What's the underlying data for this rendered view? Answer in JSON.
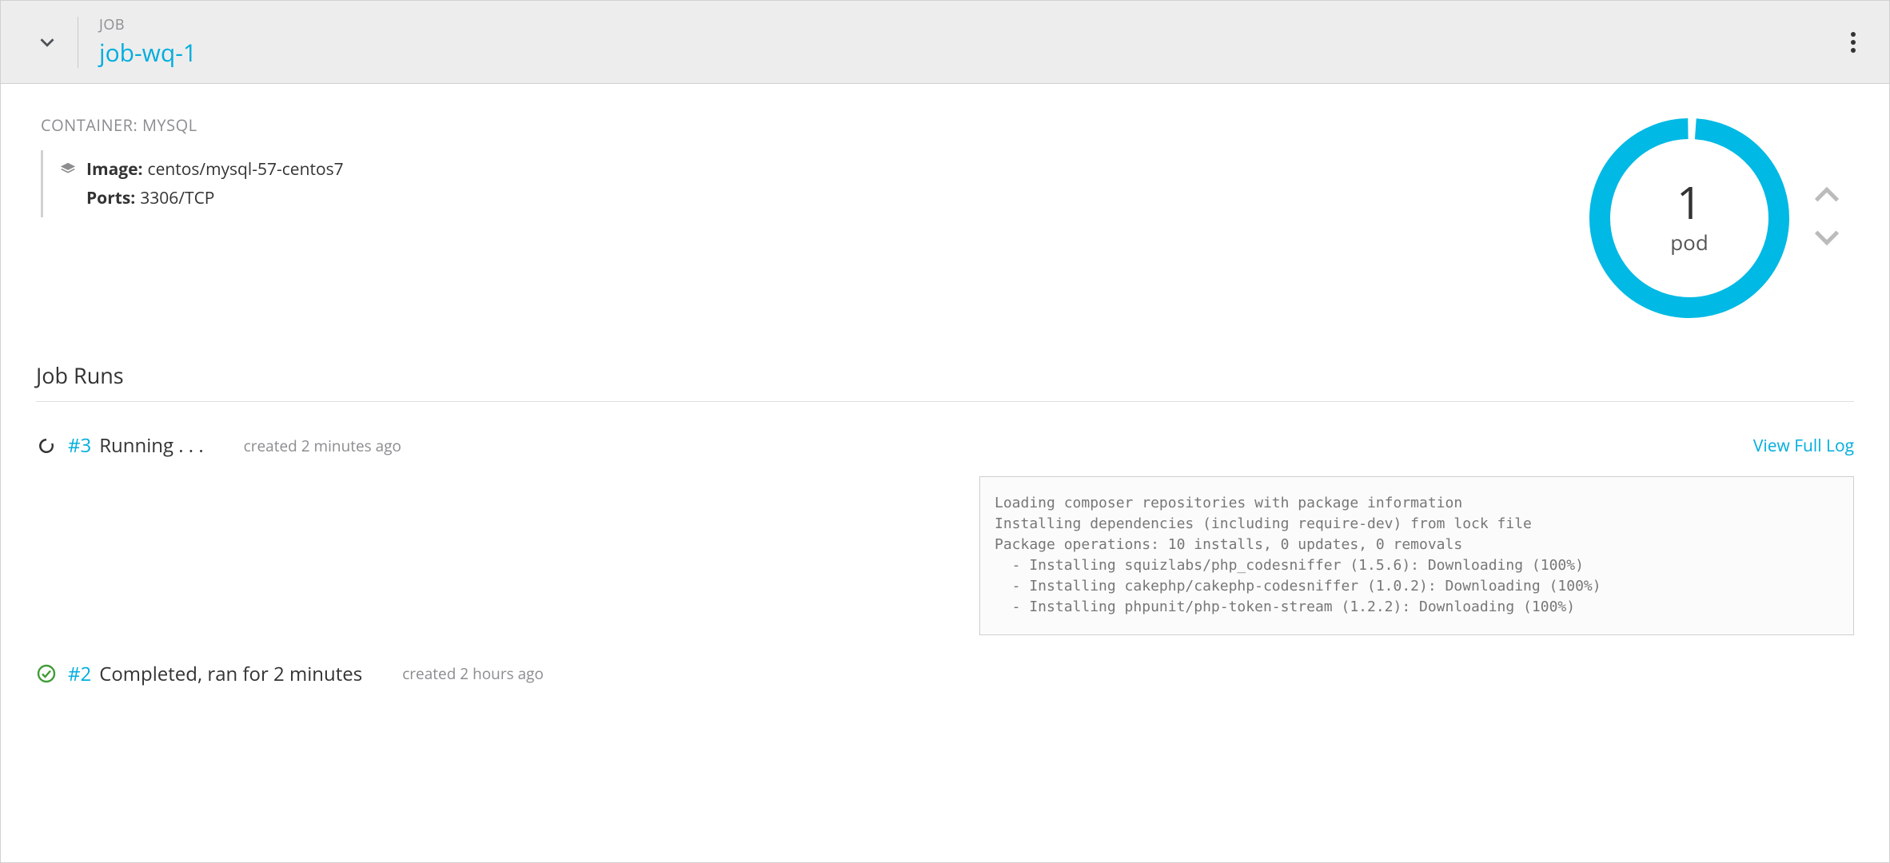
{
  "header": {
    "kind_label": "JOB",
    "name": "job-wq-1"
  },
  "container": {
    "title_prefix": "CONTAINER:",
    "title_name": "MYSQL",
    "image_key": "Image:",
    "image_val": "centos/mysql-57-centos7",
    "ports_key": "Ports:",
    "ports_val": "3306/TCP"
  },
  "pod": {
    "count": "1",
    "label": "pod",
    "ring_color": "#00b9e4"
  },
  "section_runs_title": "Job Runs",
  "runs": {
    "r0": {
      "id": "#3",
      "status": "Running . . .",
      "created": "created 2 minutes ago",
      "view_full_log": "View Full Log",
      "log": "Loading composer repositories with package information\nInstalling dependencies (including require-dev) from lock file\nPackage operations: 10 installs, 0 updates, 0 removals\n  - Installing squizlabs/php_codesniffer (1.5.6): Downloading (100%)\n  - Installing cakephp/cakephp-codesniffer (1.0.2): Downloading (100%)\n  - Installing phpunit/php-token-stream (1.2.2): Downloading (100%)"
    },
    "r1": {
      "id": "#2",
      "status": "Completed, ran for 2 minutes",
      "created": "created 2 hours ago"
    }
  }
}
